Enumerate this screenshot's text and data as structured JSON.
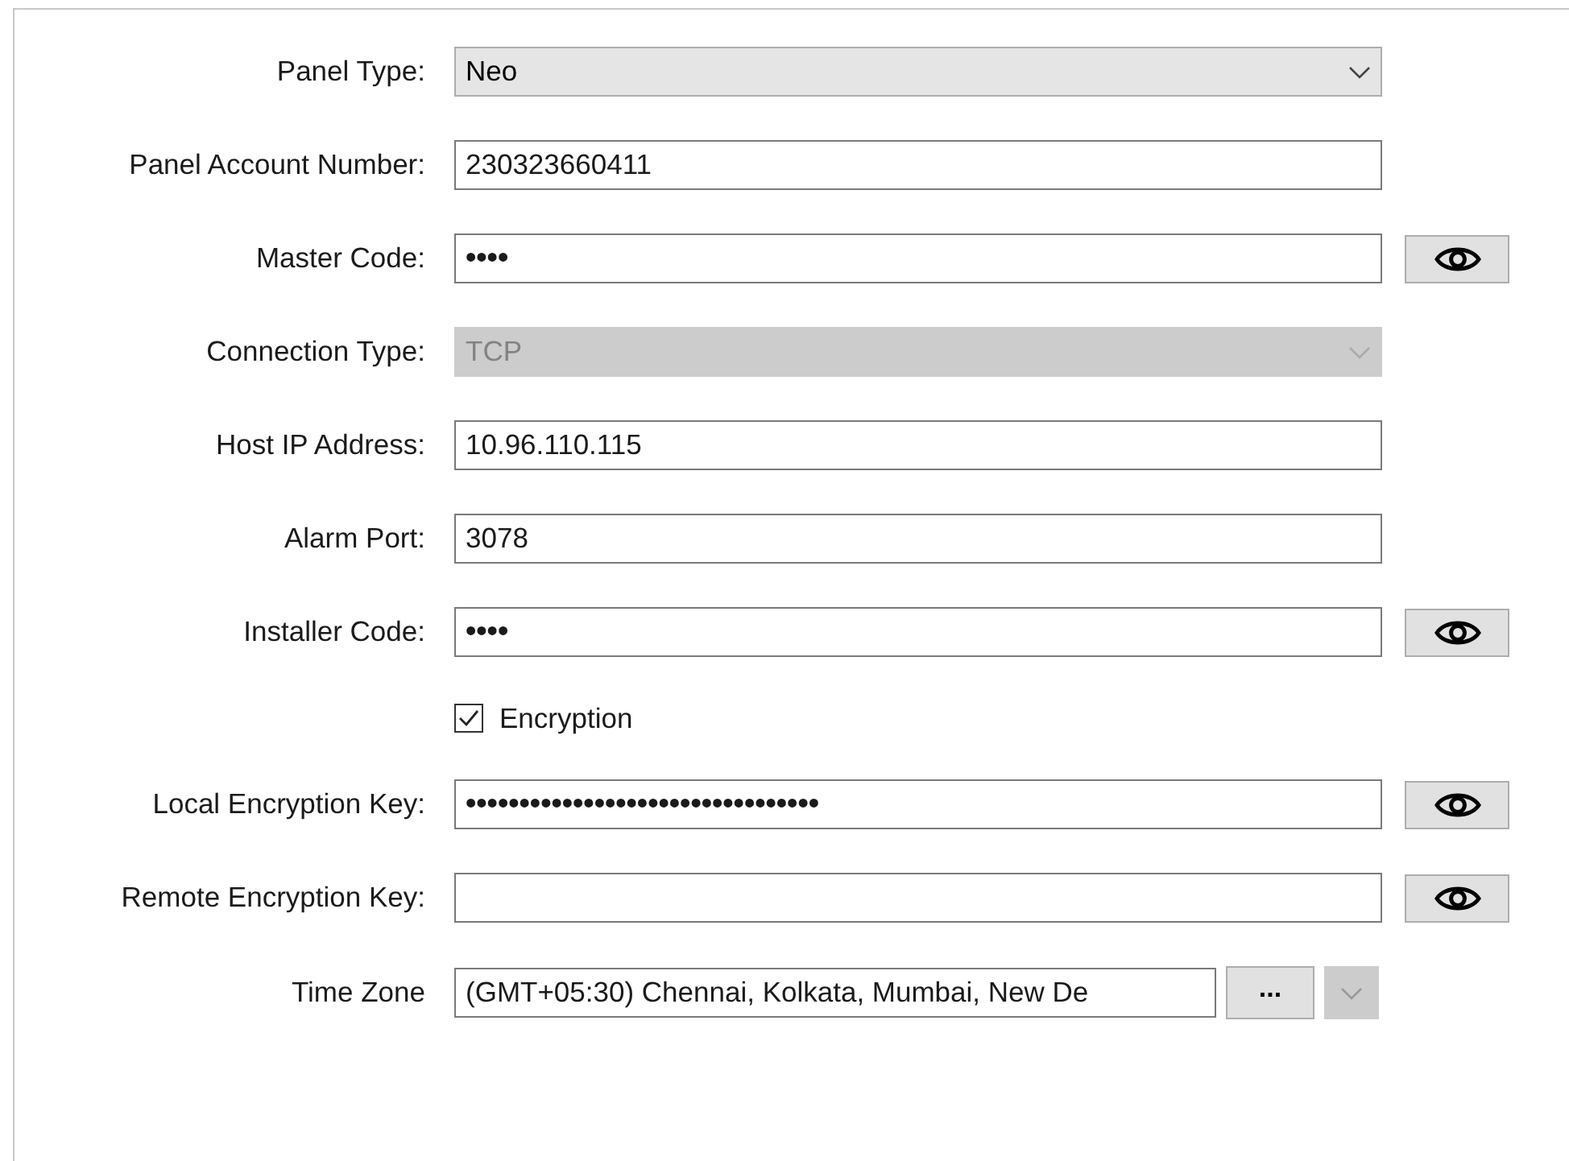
{
  "fields": [
    {
      "kind": "dropdown",
      "label": "Panel Type:",
      "value": "Neo",
      "disabled": false
    },
    {
      "kind": "text",
      "label": "Panel Account Number:",
      "value": "230323660411"
    },
    {
      "kind": "password",
      "label": "Master Code:",
      "value": "••••"
    },
    {
      "kind": "dropdown",
      "label": "Connection Type:",
      "value": "TCP",
      "disabled": true
    },
    {
      "kind": "text",
      "label": "Host IP Address:",
      "value": "10.96.110.115"
    },
    {
      "kind": "text",
      "label": "Alarm Port:",
      "value": "3078"
    },
    {
      "kind": "password",
      "label": "Installer Code:",
      "value": "••••"
    },
    {
      "kind": "checkbox",
      "label": "Encryption",
      "checked": true
    },
    {
      "kind": "password",
      "label": "Local Encryption Key:",
      "value": "•••••••••••••••••••••••••••••••••"
    },
    {
      "kind": "password",
      "label": "Remote Encryption Key:"
    },
    {
      "kind": "timezone",
      "label": "Time Zone",
      "value": "(GMT+05:30) Chennai, Kolkata, Mumbai, New De",
      "browse": "...",
      "disabled": true
    }
  ]
}
